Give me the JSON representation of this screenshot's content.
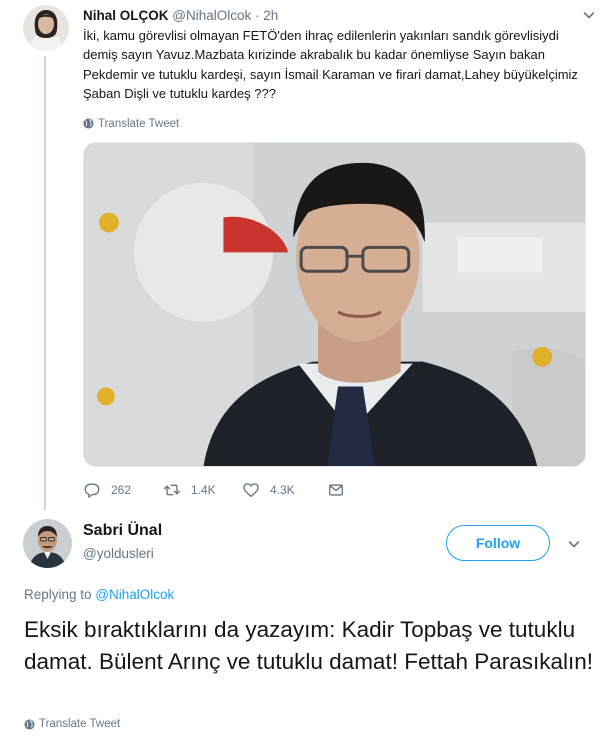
{
  "parent_tweet": {
    "author_name": "Nihal OLÇOK",
    "author_handle": "@NihalOlcok",
    "separator": "·",
    "time": "2h",
    "text": "İki, kamu görevlisi olmayan FETÖ'den ihraç edilenlerin yakınları sandık görevlisiydi demiş sayın Yavuz.Mazbata kırizinde akrabalık bu kadar önemliyse Sayın bakan Pekdemir ve tutuklu kardeşi, sayın İsmail Karaman ve firari damat,Lahey büyükelçimiz Şaban Dişli ve tutuklu kardeş ???",
    "translate_label": "Translate Tweet",
    "stats": {
      "replies": "262",
      "retweets": "1.4K",
      "likes": "4.3K"
    }
  },
  "reply_tweet": {
    "author_name": "Sabri Ünal",
    "author_handle": "@yoldusleri",
    "follow_label": "Follow",
    "replying_to_prefix": "Replying to",
    "replying_to_handle": "@NihalOlcok",
    "text": "Eksik bıraktıklarını da yazayım: Kadir Topbaş ve tutuklu damat. Bülent Arınç ve tutuklu damat! Fettah Parasıkalın!",
    "translate_label": "Translate Tweet"
  },
  "icons": {
    "reply": "reply-icon",
    "retweet": "retweet-icon",
    "like": "heart-icon",
    "dm": "envelope-icon",
    "more": "chevron-down-icon",
    "translate": "globe-icon"
  },
  "colors": {
    "accent": "#1da1f2",
    "text": "#14171a",
    "muted": "#657786",
    "thread_line": "#cdd6df"
  }
}
